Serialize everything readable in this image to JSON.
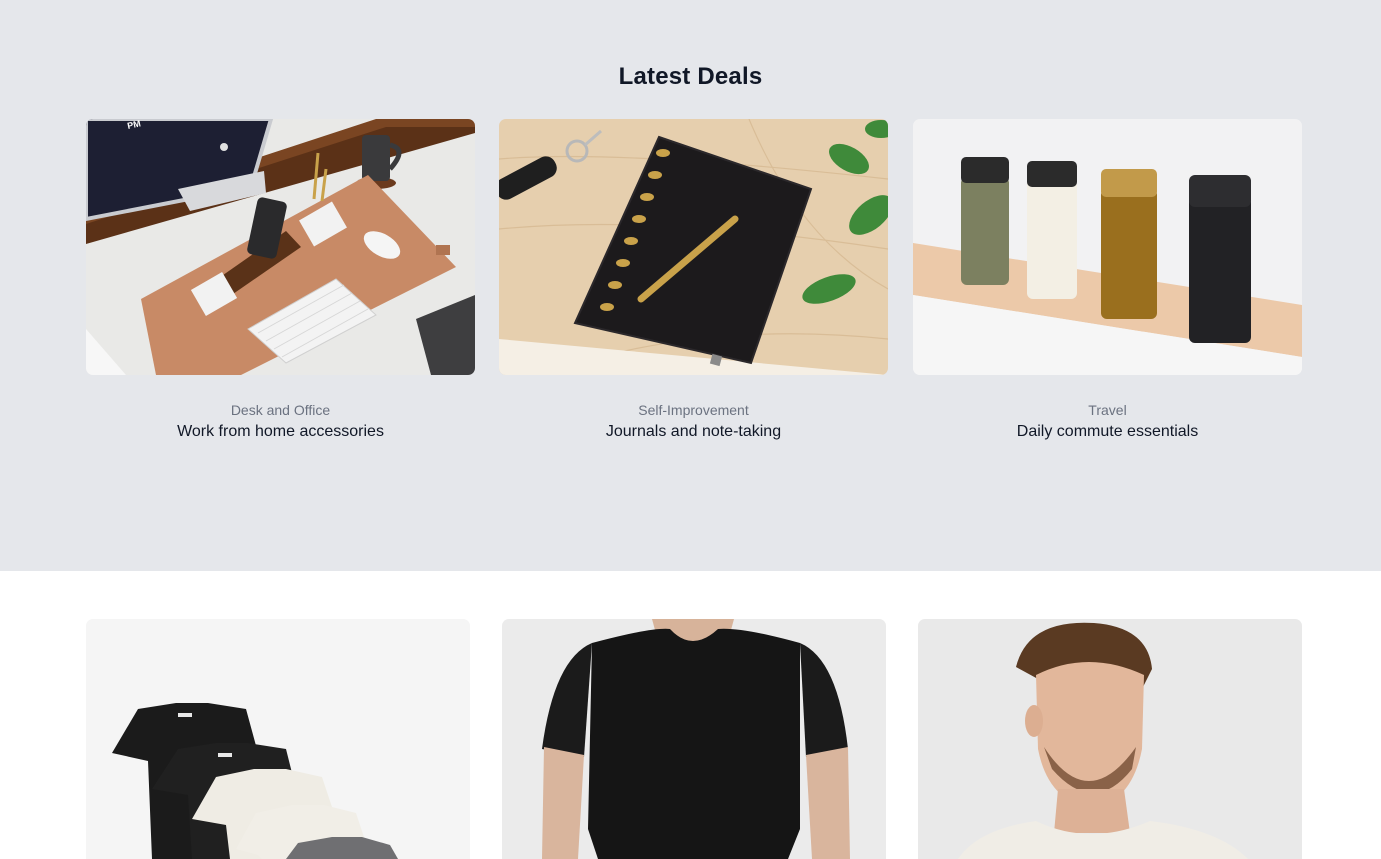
{
  "deals": {
    "title": "Latest Deals",
    "items": [
      {
        "category": "Desk and Office",
        "name": "Work from home accessories"
      },
      {
        "category": "Self-Improvement",
        "name": "Journals and note-taking"
      },
      {
        "category": "Travel",
        "name": "Daily commute essentials"
      }
    ]
  },
  "products": {
    "items": [
      {
        "image": "stacked-tshirts-photo"
      },
      {
        "image": "man-black-tshirt-photo"
      },
      {
        "image": "man-white-tshirt-photo"
      }
    ]
  },
  "colors": {
    "deals_background": "#e5e7eb",
    "products_background": "#ffffff",
    "heading": "#111827",
    "category_text": "#6b7280"
  }
}
